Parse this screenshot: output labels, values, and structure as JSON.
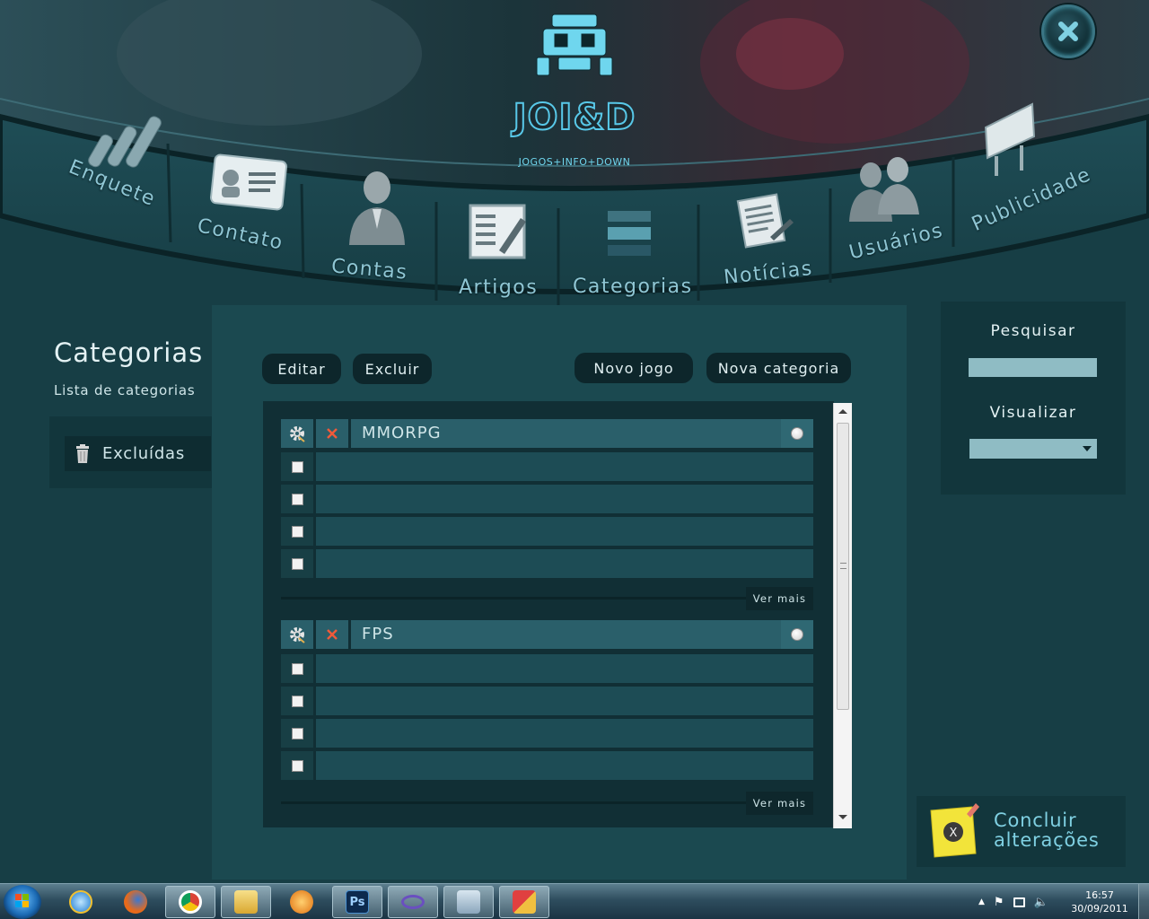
{
  "header": {
    "logo_text": "JOI&D",
    "logo_subtitle": "JOGOS+INFO+DOWN",
    "close_icon": "close-icon"
  },
  "nav": [
    {
      "label": "Enquete",
      "icon": "poll-bars-icon"
    },
    {
      "label": "Contato",
      "icon": "contact-card-icon"
    },
    {
      "label": "Contas",
      "icon": "person-icon"
    },
    {
      "label": "Artigos",
      "icon": "article-edit-icon"
    },
    {
      "label": "Categorias",
      "icon": "categories-stack-icon"
    },
    {
      "label": "Notícias",
      "icon": "news-paper-icon"
    },
    {
      "label": "Usuários",
      "icon": "users-icon"
    },
    {
      "label": "Publicidade",
      "icon": "billboard-icon"
    }
  ],
  "page": {
    "title": "Categorias",
    "subtitle": "Lista de categorias",
    "trash_label": "Excluídas"
  },
  "toolbar": {
    "edit_label": "Editar",
    "delete_label": "Excluir",
    "new_game_label": "Novo jogo",
    "new_category_label": "Nova categoria"
  },
  "categories": [
    {
      "name": "MMORPG",
      "items": [
        "",
        "",
        "",
        ""
      ],
      "more_label": "Ver mais"
    },
    {
      "name": "FPS",
      "items": [
        "",
        "",
        "",
        ""
      ],
      "more_label": "Ver mais"
    }
  ],
  "sidebar_right": {
    "search_label": "Pesquisar",
    "search_value": "",
    "view_label": "Visualizar",
    "view_value": ""
  },
  "conclude": {
    "line1": "Concluir",
    "line2": "alterações"
  },
  "taskbar": {
    "apps": [
      "internet-explorer-icon",
      "firefox-icon",
      "chrome-icon",
      "explorer-folder-icon",
      "media-player-icon",
      "photoshop-icon",
      "visual-studio-icon",
      "calculator-icon",
      "paint-icon"
    ],
    "photoshop_text": "Ps",
    "time": "16:57",
    "date": "30/09/2011"
  },
  "colors": {
    "background": "#173e45",
    "panel": "#12363c",
    "accent": "#7fd0e2",
    "row_header": "#2a5f6a",
    "row": "#1d4c55"
  }
}
